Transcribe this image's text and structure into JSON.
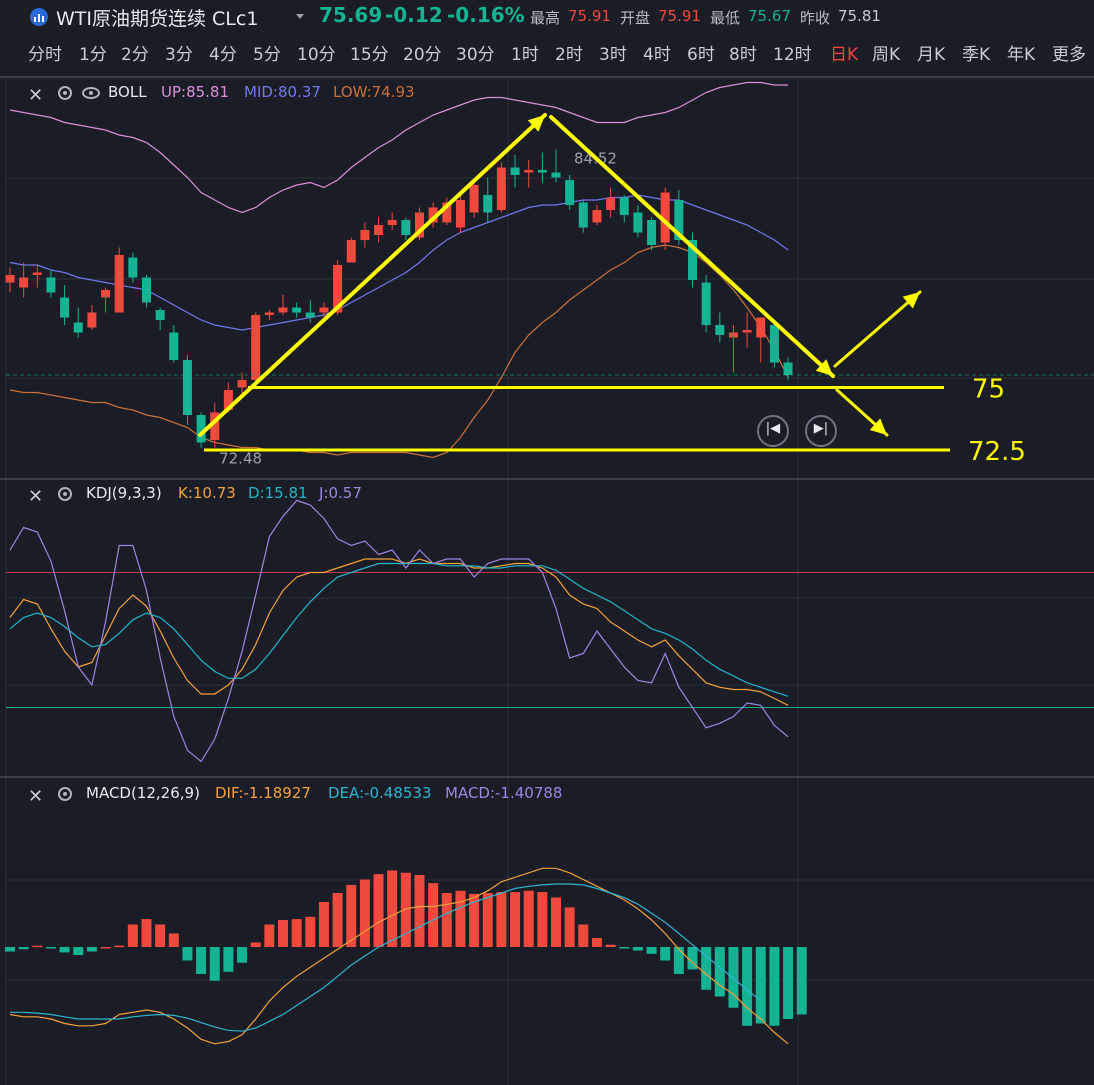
{
  "header": {
    "title": "WTI原油期货连续 CLc1",
    "price": "75.69",
    "change": "-0.12",
    "change_pct": "-0.16%",
    "high_label": "最高",
    "high": "75.91",
    "open_label": "开盘",
    "open": "75.91",
    "low_label": "最低",
    "low": "75.67",
    "prev_label": "昨收",
    "prev": "75.81",
    "colors": {
      "up": "#f0493e",
      "down": "#13b393"
    }
  },
  "tabs": [
    {
      "label": "分时"
    },
    {
      "label": "1分"
    },
    {
      "label": "2分"
    },
    {
      "label": "3分"
    },
    {
      "label": "4分"
    },
    {
      "label": "5分"
    },
    {
      "label": "10分"
    },
    {
      "label": "15分"
    },
    {
      "label": "20分"
    },
    {
      "label": "30分"
    },
    {
      "label": "1时"
    },
    {
      "label": "2时"
    },
    {
      "label": "3时"
    },
    {
      "label": "4时"
    },
    {
      "label": "6时"
    },
    {
      "label": "8时"
    },
    {
      "label": "12时"
    },
    {
      "label": "日K",
      "active": true
    },
    {
      "label": "周K"
    },
    {
      "label": "月K"
    },
    {
      "label": "季K"
    },
    {
      "label": "年K"
    },
    {
      "label": "更多"
    }
  ],
  "boll_header": {
    "name": "BOLL",
    "up": "UP:85.81",
    "mid": "MID:80.37",
    "low": "LOW:74.93"
  },
  "kdj_header": {
    "name": "KDJ(9,3,3)",
    "k": "K:10.73",
    "d": "D:15.81",
    "j": "J:0.57"
  },
  "macd_header": {
    "name": "MACD(12,26,9)",
    "dif": "DIF:-1.18927",
    "dea": "DEA:-0.48533",
    "macd": "MACD:-1.40788"
  },
  "chart_data": [
    {
      "type": "candlestick",
      "panel": "BOLL",
      "ylim": [
        71.5,
        87.3
      ],
      "max_label": "84.52",
      "min_label": "72.48",
      "annotation_labels": [
        "75",
        "72.5"
      ],
      "annotation_levels": [
        75,
        72.5
      ],
      "colors": {
        "up": "#f0493e",
        "down": "#13b393",
        "boll_up": "#d98fd8",
        "boll_mid": "#6f78e8",
        "boll_low": "#c8703a",
        "annotation": "#ffff00"
      },
      "ohlc": [
        [
          79.2,
          79.8,
          78.8,
          79.5
        ],
        [
          79.0,
          80.0,
          78.6,
          79.4
        ],
        [
          79.5,
          79.9,
          79.0,
          79.6
        ],
        [
          79.4,
          79.7,
          78.6,
          78.8
        ],
        [
          78.6,
          79.1,
          77.5,
          77.8
        ],
        [
          77.6,
          78.2,
          77.0,
          77.2
        ],
        [
          77.4,
          78.3,
          77.3,
          78.0
        ],
        [
          78.6,
          79.0,
          78.0,
          78.9
        ],
        [
          78.0,
          80.6,
          78.0,
          80.3
        ],
        [
          80.2,
          80.4,
          79.2,
          79.4
        ],
        [
          79.4,
          79.5,
          78.2,
          78.4
        ],
        [
          78.1,
          78.2,
          77.3,
          77.7
        ],
        [
          77.2,
          77.5,
          76.0,
          76.1
        ],
        [
          76.1,
          76.3,
          73.5,
          73.9
        ],
        [
          73.9,
          74.0,
          72.6,
          72.8
        ],
        [
          72.9,
          74.4,
          72.6,
          74.0
        ],
        [
          74.1,
          75.2,
          74.0,
          74.9
        ],
        [
          75.0,
          75.6,
          74.6,
          75.3
        ],
        [
          75.3,
          78.0,
          75.1,
          77.9
        ],
        [
          77.9,
          78.1,
          77.7,
          78.0
        ],
        [
          78.0,
          78.7,
          77.9,
          78.2
        ],
        [
          78.2,
          78.4,
          77.8,
          78.0
        ],
        [
          78.0,
          78.5,
          77.6,
          77.8
        ],
        [
          78.0,
          78.4,
          77.7,
          78.2
        ],
        [
          78.0,
          80.1,
          77.9,
          79.9
        ],
        [
          80.0,
          81.0,
          80.0,
          80.9
        ],
        [
          80.9,
          81.6,
          80.6,
          81.3
        ],
        [
          81.1,
          81.8,
          80.8,
          81.5
        ],
        [
          81.5,
          82.0,
          81.3,
          81.7
        ],
        [
          81.7,
          81.8,
          80.9,
          81.1
        ],
        [
          81.0,
          82.2,
          80.9,
          82.0
        ],
        [
          81.6,
          82.4,
          81.4,
          82.2
        ],
        [
          81.6,
          82.6,
          81.5,
          82.4
        ],
        [
          81.4,
          82.7,
          81.2,
          82.5
        ],
        [
          82.0,
          83.3,
          81.8,
          83.1
        ],
        [
          82.7,
          83.4,
          81.6,
          82.0
        ],
        [
          82.1,
          84.0,
          82.0,
          83.8
        ],
        [
          83.8,
          84.3,
          83.0,
          83.5
        ],
        [
          83.6,
          84.1,
          83.0,
          83.7
        ],
        [
          83.7,
          84.4,
          83.2,
          83.6
        ],
        [
          83.6,
          84.52,
          83.2,
          83.4
        ],
        [
          83.3,
          83.5,
          82.1,
          82.3
        ],
        [
          82.4,
          82.5,
          81.2,
          81.4
        ],
        [
          81.6,
          82.3,
          81.5,
          82.1
        ],
        [
          82.1,
          83.0,
          81.8,
          82.6
        ],
        [
          82.6,
          82.7,
          81.6,
          81.9
        ],
        [
          82.0,
          82.3,
          81.0,
          81.2
        ],
        [
          81.7,
          81.8,
          80.5,
          80.7
        ],
        [
          80.8,
          83.0,
          80.5,
          82.8
        ],
        [
          82.5,
          82.9,
          80.7,
          80.9
        ],
        [
          80.9,
          81.2,
          79.0,
          79.3
        ],
        [
          79.2,
          79.5,
          77.2,
          77.5
        ],
        [
          77.5,
          78.0,
          76.8,
          77.1
        ],
        [
          77.0,
          77.5,
          75.6,
          77.2
        ],
        [
          77.2,
          78.0,
          76.6,
          77.3
        ],
        [
          77.0,
          77.6,
          76.0,
          77.8
        ],
        [
          77.5,
          77.6,
          75.8,
          76.0
        ],
        [
          76.0,
          76.2,
          75.3,
          75.5
        ]
      ],
      "boll": {
        "up": [
          86.1,
          86.0,
          85.9,
          85.8,
          85.6,
          85.5,
          85.4,
          85.3,
          85.1,
          85.0,
          84.8,
          84.4,
          83.9,
          83.4,
          82.8,
          82.5,
          82.2,
          82.0,
          82.2,
          82.6,
          82.9,
          83.1,
          83.2,
          83.0,
          83.3,
          83.8,
          84.2,
          84.6,
          84.9,
          85.3,
          85.6,
          85.9,
          86.1,
          86.3,
          86.5,
          86.6,
          86.6,
          86.5,
          86.4,
          86.3,
          86.2,
          86.0,
          85.8,
          85.6,
          85.6,
          85.6,
          85.8,
          85.9,
          86.0,
          86.2,
          86.5,
          86.8,
          87.0,
          87.1,
          87.2,
          87.2,
          87.1,
          87.1
        ],
        "mid": [
          80.0,
          79.9,
          79.9,
          79.7,
          79.6,
          79.4,
          79.3,
          79.2,
          79.1,
          79.0,
          78.9,
          78.6,
          78.3,
          78.0,
          77.7,
          77.5,
          77.4,
          77.3,
          77.4,
          77.5,
          77.6,
          77.7,
          77.8,
          77.9,
          78.1,
          78.4,
          78.7,
          79.0,
          79.3,
          79.6,
          80.0,
          80.5,
          80.9,
          81.2,
          81.4,
          81.6,
          81.8,
          82.0,
          82.2,
          82.3,
          82.3,
          82.4,
          82.5,
          82.5,
          82.6,
          82.6,
          82.7,
          82.6,
          82.5,
          82.5,
          82.3,
          82.1,
          81.9,
          81.7,
          81.5,
          81.2,
          80.9,
          80.5
        ],
        "low": [
          74.9,
          74.8,
          74.8,
          74.7,
          74.6,
          74.5,
          74.4,
          74.4,
          74.2,
          74.1,
          73.9,
          73.8,
          73.6,
          73.4,
          73.0,
          72.8,
          72.7,
          72.6,
          72.6,
          72.5,
          72.5,
          72.5,
          72.4,
          72.4,
          72.3,
          72.4,
          72.4,
          72.4,
          72.4,
          72.4,
          72.3,
          72.2,
          72.4,
          73.0,
          73.8,
          74.5,
          75.4,
          76.4,
          77.1,
          77.6,
          78.0,
          78.5,
          78.9,
          79.3,
          79.7,
          80.0,
          80.4,
          80.6,
          80.7,
          80.6,
          80.4,
          80.0,
          79.5,
          78.9,
          78.2,
          77.4,
          76.5,
          75.4
        ]
      }
    },
    {
      "type": "line",
      "panel": "KDJ",
      "ylim": [
        -10,
        110
      ],
      "reference_levels": [
        80,
        20
      ],
      "series": [
        {
          "name": "K",
          "color": "#f2a13a",
          "values": [
            60,
            68,
            66,
            55,
            45,
            38,
            40,
            52,
            64,
            70,
            65,
            54,
            42,
            32,
            26,
            26,
            30,
            37,
            48,
            62,
            72,
            78,
            80,
            80,
            82,
            84,
            86,
            86,
            86,
            84,
            86,
            84,
            84,
            84,
            82,
            82,
            83,
            84,
            84,
            82,
            78,
            70,
            66,
            64,
            58,
            54,
            50,
            47,
            50,
            43,
            37,
            31,
            29,
            28,
            28,
            27,
            24,
            21
          ]
        },
        {
          "name": "D",
          "color": "#1fb5cb",
          "values": [
            55,
            60,
            62,
            60,
            56,
            51,
            47,
            48,
            53,
            59,
            62,
            60,
            55,
            48,
            41,
            36,
            33,
            33,
            37,
            44,
            52,
            60,
            67,
            73,
            78,
            80,
            82,
            84,
            84,
            84,
            84,
            84,
            83,
            83,
            83,
            82,
            82,
            83,
            83,
            83,
            81,
            77,
            73,
            70,
            67,
            63,
            59,
            55,
            53,
            50,
            46,
            41,
            37,
            34,
            31,
            29,
            27,
            25
          ]
        },
        {
          "name": "J",
          "color": "#a184e1",
          "values": [
            90,
            100,
            98,
            85,
            63,
            38,
            30,
            58,
            92,
            92,
            72,
            42,
            16,
            1,
            -4,
            6,
            24,
            45,
            70,
            96,
            105,
            112,
            110,
            104,
            95,
            92,
            94,
            88,
            90,
            82,
            90,
            84,
            86,
            86,
            78,
            84,
            86,
            86,
            86,
            80,
            64,
            42,
            44,
            54,
            46,
            38,
            32,
            31,
            44,
            29,
            20,
            11,
            13,
            16,
            22,
            21,
            12,
            7
          ]
        }
      ]
    },
    {
      "type": "bar+line",
      "panel": "MACD",
      "ylim": [
        -3.0,
        3.0
      ],
      "series": [
        {
          "name": "MACD",
          "type": "bar",
          "values": [
            -0.1,
            -0.05,
            0.03,
            -0.02,
            -0.12,
            -0.18,
            -0.1,
            0.0,
            0.03,
            0.5,
            0.62,
            0.5,
            0.3,
            -0.3,
            -0.6,
            -0.75,
            -0.55,
            -0.35,
            0.1,
            0.5,
            0.6,
            0.62,
            0.67,
            1.0,
            1.2,
            1.38,
            1.5,
            1.62,
            1.7,
            1.65,
            1.6,
            1.42,
            1.2,
            1.25,
            1.18,
            1.2,
            1.22,
            1.22,
            1.25,
            1.22,
            1.1,
            0.88,
            0.5,
            0.2,
            0.05,
            -0.02,
            -0.08,
            -0.15,
            -0.3,
            -0.6,
            -0.5,
            -0.95,
            -1.1,
            -1.35,
            -1.75,
            -1.7,
            -1.75,
            -1.6,
            -1.5
          ]
        },
        {
          "name": "DIF",
          "type": "line",
          "color": "#f2a13a",
          "values": [
            -1.5,
            -1.55,
            -1.55,
            -1.6,
            -1.7,
            -1.75,
            -1.75,
            -1.7,
            -1.5,
            -1.45,
            -1.4,
            -1.45,
            -1.6,
            -1.8,
            -2.05,
            -2.15,
            -2.1,
            -1.95,
            -1.6,
            -1.2,
            -0.9,
            -0.65,
            -0.45,
            -0.25,
            -0.05,
            0.15,
            0.35,
            0.55,
            0.7,
            0.85,
            0.9,
            0.9,
            0.95,
            1.0,
            1.1,
            1.25,
            1.45,
            1.55,
            1.65,
            1.75,
            1.75,
            1.65,
            1.5,
            1.35,
            1.2,
            1.05,
            0.85,
            0.6,
            0.3,
            -0.05,
            -0.35,
            -0.6,
            -0.85,
            -1.05,
            -1.35,
            -1.6,
            -1.9,
            -2.15
          ]
        },
        {
          "name": "DEA",
          "type": "line",
          "color": "#2fb4d0",
          "values": [
            -1.45,
            -1.45,
            -1.47,
            -1.5,
            -1.55,
            -1.6,
            -1.6,
            -1.6,
            -1.6,
            -1.55,
            -1.52,
            -1.5,
            -1.52,
            -1.58,
            -1.68,
            -1.78,
            -1.85,
            -1.87,
            -1.8,
            -1.65,
            -1.5,
            -1.3,
            -1.1,
            -0.9,
            -0.65,
            -0.4,
            -0.2,
            0.0,
            0.15,
            0.3,
            0.45,
            0.6,
            0.75,
            0.88,
            1.0,
            1.1,
            1.2,
            1.3,
            1.35,
            1.38,
            1.4,
            1.4,
            1.38,
            1.3,
            1.2,
            1.1,
            0.95,
            0.75,
            0.55,
            0.3,
            0.05,
            -0.2,
            -0.45,
            -0.7,
            -0.95,
            -1.2
          ]
        }
      ]
    }
  ]
}
